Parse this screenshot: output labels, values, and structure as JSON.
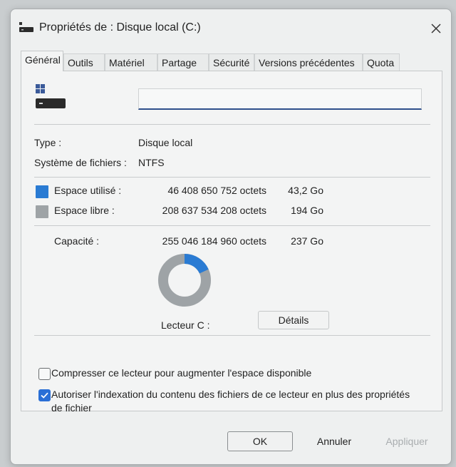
{
  "window": {
    "title": "Propriétés de : Disque local (C:)"
  },
  "tabs": [
    {
      "label": "Général",
      "active": true
    },
    {
      "label": "Outils"
    },
    {
      "label": "Matériel"
    },
    {
      "label": "Partage"
    },
    {
      "label": "Sécurité"
    },
    {
      "label": "Versions précédentes"
    },
    {
      "label": "Quota"
    }
  ],
  "general": {
    "name_value": "",
    "type_label": "Type :",
    "type_value": "Disque local",
    "fs_label": "Système de fichiers :",
    "fs_value": "NTFS",
    "used_label": "Espace utilisé :",
    "used_bytes": "46 408 650 752 octets",
    "used_short": "43,2 Go",
    "free_label": "Espace libre :",
    "free_bytes": "208 637 534 208 octets",
    "free_short": "194 Go",
    "capacity_label": "Capacité :",
    "capacity_bytes": "255 046 184 960 octets",
    "capacity_short": "237 Go",
    "drive_label": "Lecteur C :",
    "details_button": "Détails",
    "compress_label": "Compresser ce lecteur pour augmenter l'espace disponible",
    "compress_checked": false,
    "index_label": "Autoriser l'indexation du contenu des fichiers de ce lecteur en plus des propriétés de fichier",
    "index_checked": true,
    "used_fraction": 0.182
  },
  "colors": {
    "used": "#2a7bd3",
    "free": "#9ea3a6",
    "accent": "#2a6fd6"
  },
  "footer": {
    "ok": "OK",
    "cancel": "Annuler",
    "apply": "Appliquer"
  }
}
